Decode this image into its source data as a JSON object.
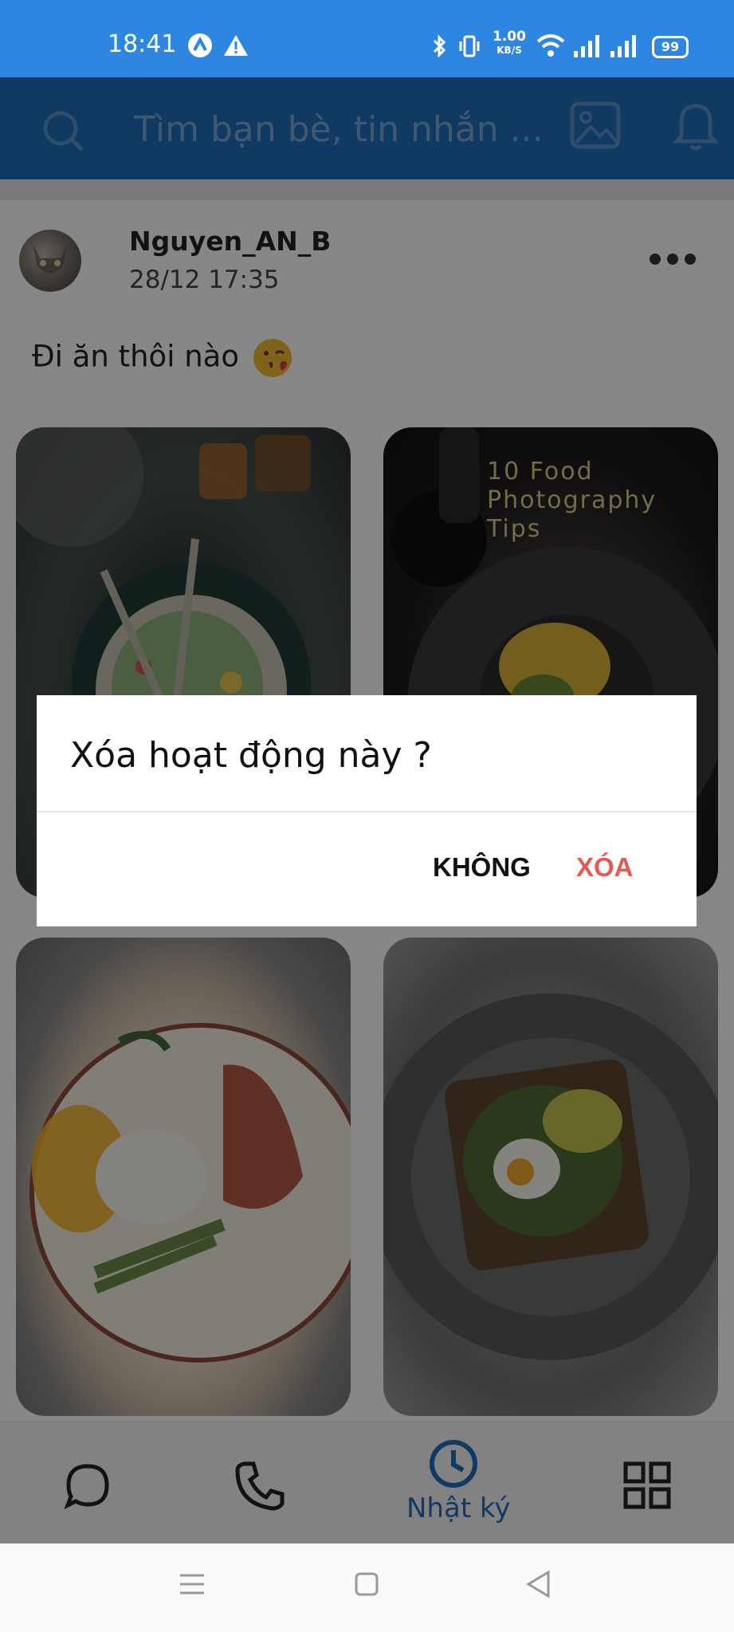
{
  "status_bar": {
    "time": "18:41",
    "network_speed_value": "1.00",
    "network_speed_unit": "KB/S",
    "battery": "99"
  },
  "search": {
    "placeholder": "Tìm bạn bè, tin nhắn ..."
  },
  "post": {
    "author": "Nguyen_AN_B",
    "time": "28/12 17:35",
    "text": "Đi ăn thôi nào",
    "emoji": "kissing-face-emoji",
    "photo_overlay_text_line1": "10 Food",
    "photo_overlay_text_line2": "Photography Tips"
  },
  "dialog": {
    "title": "Xóa hoạt động này ?",
    "cancel_label": "KHÔNG",
    "confirm_label": "XÓA"
  },
  "bottom_nav": {
    "items": [
      {
        "icon": "chat-bubble-icon",
        "label": ""
      },
      {
        "icon": "phone-icon",
        "label": ""
      },
      {
        "icon": "clock-icon",
        "label": "Nhật ký",
        "active": true
      },
      {
        "icon": "grid-icon",
        "label": ""
      }
    ]
  },
  "colors": {
    "status_bar": "#2f86e0",
    "app_bar": "#1f6fb8",
    "active_nav": "#1f6fb8",
    "delete_button": "#e25b54"
  }
}
